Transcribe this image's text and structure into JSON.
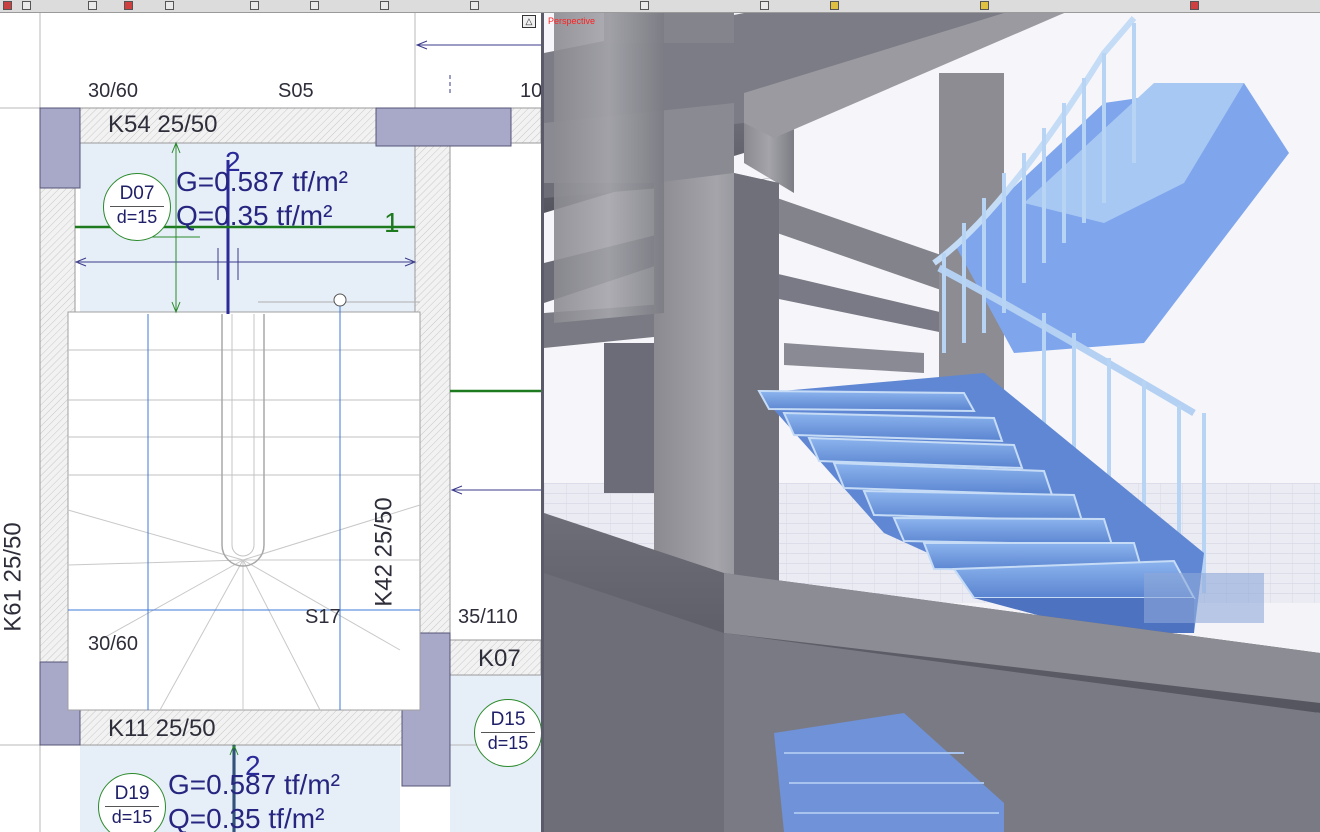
{
  "toolbar": {
    "icons": [
      "select-icon",
      "line-icon",
      "window-icon",
      "flag-icon",
      "delete-icon",
      "table-icon",
      "column-icon",
      "text-icon",
      "slab-icon",
      "view-icon",
      "rotate-icon",
      "dimension-icon",
      "layer-icon",
      "settings-icon"
    ]
  },
  "plan": {
    "dim_top_left": "30/60",
    "column_top": "S05",
    "dim_top_right": "10",
    "beam_top": "K54 25/50",
    "beam_left": "K61 25/50",
    "beam_right": "K42 25/50",
    "beam_bottom": "K11 25/50",
    "beam_right_stub": "K07",
    "column_mid": "S17",
    "dim_mid_right": "35/110",
    "dim_bottom_left": "30/60",
    "slab_main": {
      "id": "D07",
      "d": "d=15",
      "g": "G=0.587 tf/m²",
      "q": "Q=0.35 tf/m²"
    },
    "slab_bottom": {
      "id": "D19",
      "d": "d=15",
      "g": "G=0.587 tf/m²",
      "q": "Q=0.35 tf/m²"
    },
    "slab_right": {
      "id": "D15",
      "d": "d=15"
    },
    "axis_marker_top": "2",
    "axis_marker_bottom": "2",
    "axis_marker_green": "1"
  },
  "view3d": {
    "title": "Perspective",
    "collapse_symbol": "△"
  },
  "colors": {
    "slab_fill": "#e6eef8",
    "column_fill": "#a8a8c8",
    "beam_hatch": "#d6d6d6",
    "stair": "#6a90d8",
    "concrete": "#8e8e94",
    "plan_text": "#2e2e3a",
    "load_text": "#262680"
  }
}
